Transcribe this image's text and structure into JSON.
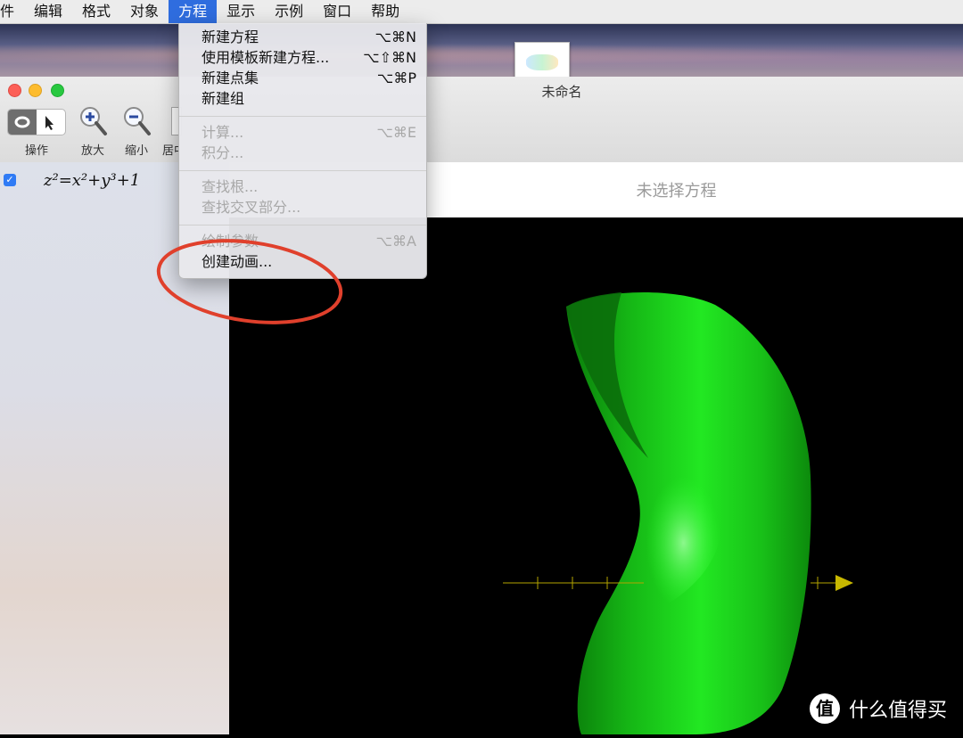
{
  "menubar": {
    "items": [
      "件",
      "编辑",
      "格式",
      "对象",
      "方程",
      "显示",
      "示例",
      "窗口",
      "帮助"
    ],
    "active_index": 4,
    "active_color": "#2f6ddf"
  },
  "window": {
    "title": "未命名"
  },
  "toolbar": {
    "action_label": "操作",
    "zoom_in_label": "放大",
    "zoom_out_label": "缩小",
    "center_label": "居中"
  },
  "sidebar": {
    "equation": "z²=x²+y³+1",
    "checked": true
  },
  "status": {
    "no_selection": "未选择方程"
  },
  "dropdown": {
    "groups": [
      [
        {
          "label": "新建方程",
          "shortcut": "⌥⌘N",
          "enabled": true
        },
        {
          "label": "使用模板新建方程...",
          "shortcut": "⌥⇧⌘N",
          "enabled": true
        },
        {
          "label": "新建点集",
          "shortcut": "⌥⌘P",
          "enabled": true
        },
        {
          "label": "新建组",
          "shortcut": "",
          "enabled": true
        }
      ],
      [
        {
          "label": "计算...",
          "shortcut": "⌥⌘E",
          "enabled": false
        },
        {
          "label": "积分...",
          "shortcut": "",
          "enabled": false
        }
      ],
      [
        {
          "label": "查找根...",
          "shortcut": "",
          "enabled": false
        },
        {
          "label": "查找交叉部分...",
          "shortcut": "",
          "enabled": false
        }
      ],
      [
        {
          "label": "绘制参数",
          "shortcut": "⌥⌘A",
          "enabled": false
        },
        {
          "label": "创建动画...",
          "shortcut": "",
          "enabled": true
        }
      ]
    ]
  },
  "watermark": {
    "badge": "值",
    "text": "什么值得买"
  },
  "colors": {
    "surface": "#18e018",
    "axis": "#b3a400",
    "annotation": "#e0402c"
  }
}
